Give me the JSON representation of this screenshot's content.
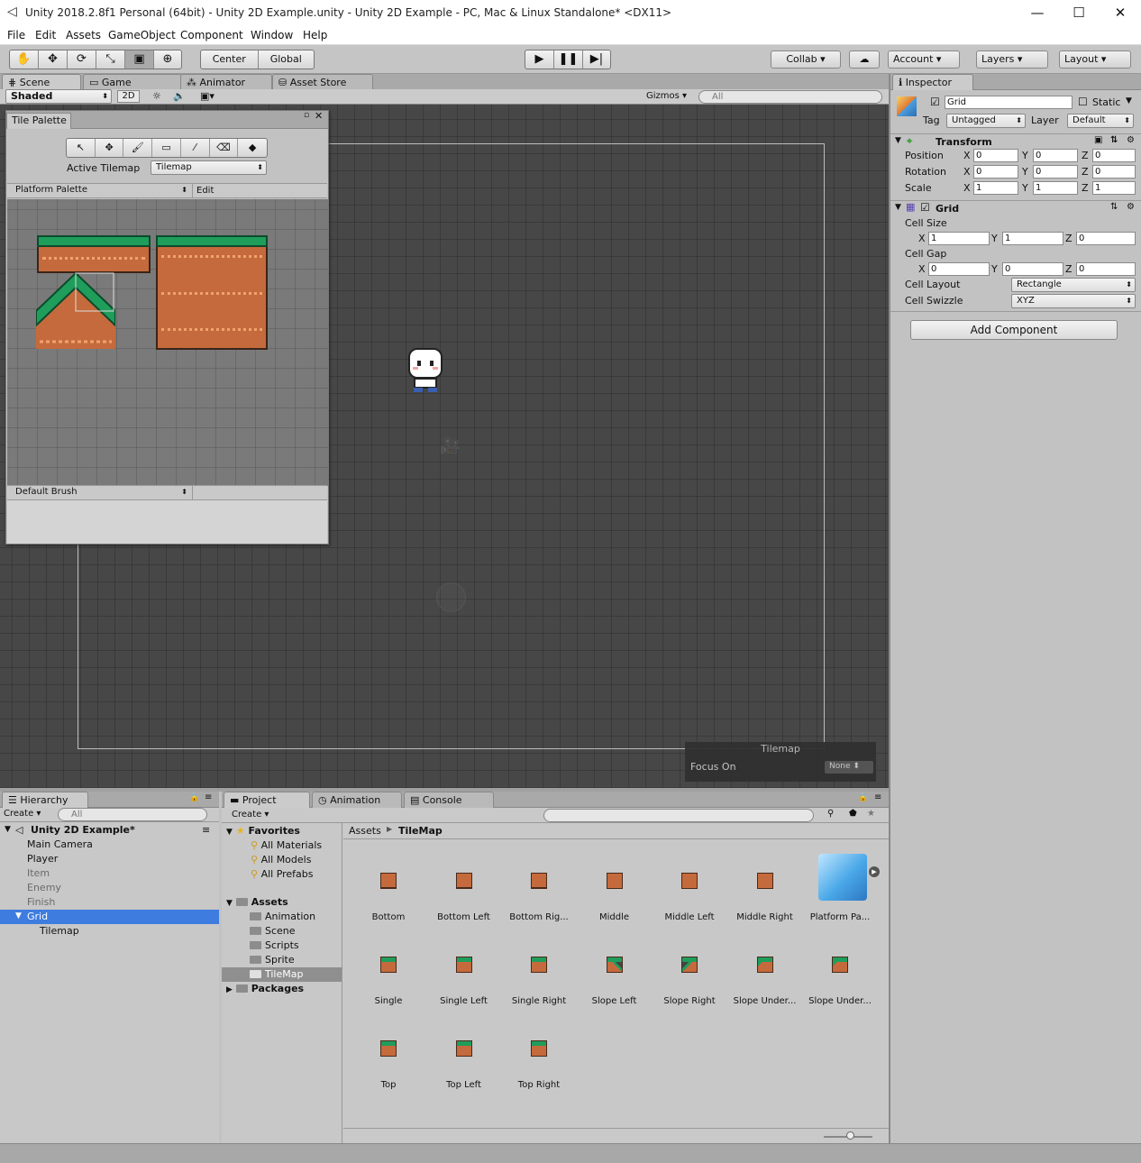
{
  "window": {
    "title": "Unity 2018.2.8f1 Personal (64bit) - Unity 2D Example.unity - Unity 2D Example - PC, Mac & Linux Standalone* <DX11>",
    "minimize": "—",
    "maximize": "☐",
    "close": "✕"
  },
  "menu": [
    "File",
    "Edit",
    "Assets",
    "GameObject",
    "Component",
    "Window",
    "Help"
  ],
  "toolbar": {
    "center": "Center",
    "global": "Global",
    "collab": "Collab ▾",
    "account": "Account",
    "layers": "Layers",
    "layout": "Layout"
  },
  "tabs": {
    "scene": "Scene",
    "game": "Game",
    "animator": "Animator",
    "asset_store": "Asset Store",
    "inspector": "Inspector",
    "hierarchy": "Hierarchy",
    "project": "Project",
    "animation": "Animation",
    "console": "Console"
  },
  "scene_toolbar": {
    "shading": "Shaded",
    "mode_2d": "2D",
    "gizmos": "Gizmos ▾",
    "search_placeholder": "All"
  },
  "tile_palette": {
    "title": "Tile Palette",
    "active_tilemap_label": "Active Tilemap",
    "active_tilemap": "Tilemap",
    "palette": "Platform Palette",
    "edit": "Edit",
    "brush": "Default Brush"
  },
  "tilemap_overlay": {
    "title": "Tilemap",
    "focus_label": "Focus On",
    "focus_value": "None"
  },
  "inspector": {
    "object_name": "Grid",
    "static": "Static",
    "tag_label": "Tag",
    "tag": "Untagged",
    "layer_label": "Layer",
    "layer": "Default",
    "transform": {
      "title": "Transform",
      "position_label": "Position",
      "rotation_label": "Rotation",
      "scale_label": "Scale",
      "position": [
        "0",
        "0",
        "0"
      ],
      "rotation": [
        "0",
        "0",
        "0"
      ],
      "scale": [
        "1",
        "1",
        "1"
      ]
    },
    "grid": {
      "title": "Grid",
      "cell_size_label": "Cell Size",
      "cell_size": [
        "1",
        "1",
        "0"
      ],
      "cell_gap_label": "Cell Gap",
      "cell_gap": [
        "0",
        "0",
        "0"
      ],
      "cell_layout_label": "Cell Layout",
      "cell_layout": "Rectangle",
      "cell_swizzle_label": "Cell Swizzle",
      "cell_swizzle": "XYZ"
    },
    "add_component": "Add Component",
    "axis": {
      "x": "X",
      "y": "Y",
      "z": "Z"
    }
  },
  "hierarchy": {
    "create": "Create ▾",
    "search_placeholder": "All",
    "scene": "Unity 2D Example*",
    "items": [
      {
        "label": "Main Camera"
      },
      {
        "label": "Player"
      },
      {
        "label": "Item"
      },
      {
        "label": "Enemy"
      },
      {
        "label": "Finish"
      },
      {
        "label": "Grid"
      },
      {
        "label": "Tilemap"
      }
    ]
  },
  "project": {
    "create": "Create ▾",
    "favorites": "Favorites",
    "fav_items": [
      "All Materials",
      "All Models",
      "All Prefabs"
    ],
    "assets": "Assets",
    "folders": [
      "Animation",
      "Scene",
      "Scripts",
      "Sprite",
      "TileMap"
    ],
    "packages": "Packages",
    "breadcrumb": [
      "Assets",
      "TileMap"
    ],
    "grid_items": [
      "Bottom",
      "Bottom Left",
      "Bottom Rig...",
      "Middle",
      "Middle Left",
      "Middle Right",
      "Platform Pa...",
      "Single",
      "Single Left",
      "Single Right",
      "Slope Left",
      "Slope Right",
      "Slope Under...",
      "Slope Under...",
      "Top",
      "Top Left",
      "Top Right"
    ]
  },
  "colors": {
    "accent": "#3e7ce0",
    "scene_bg": "#474747",
    "grass": "#1f9d5b",
    "dirt": "#c56a3c"
  }
}
